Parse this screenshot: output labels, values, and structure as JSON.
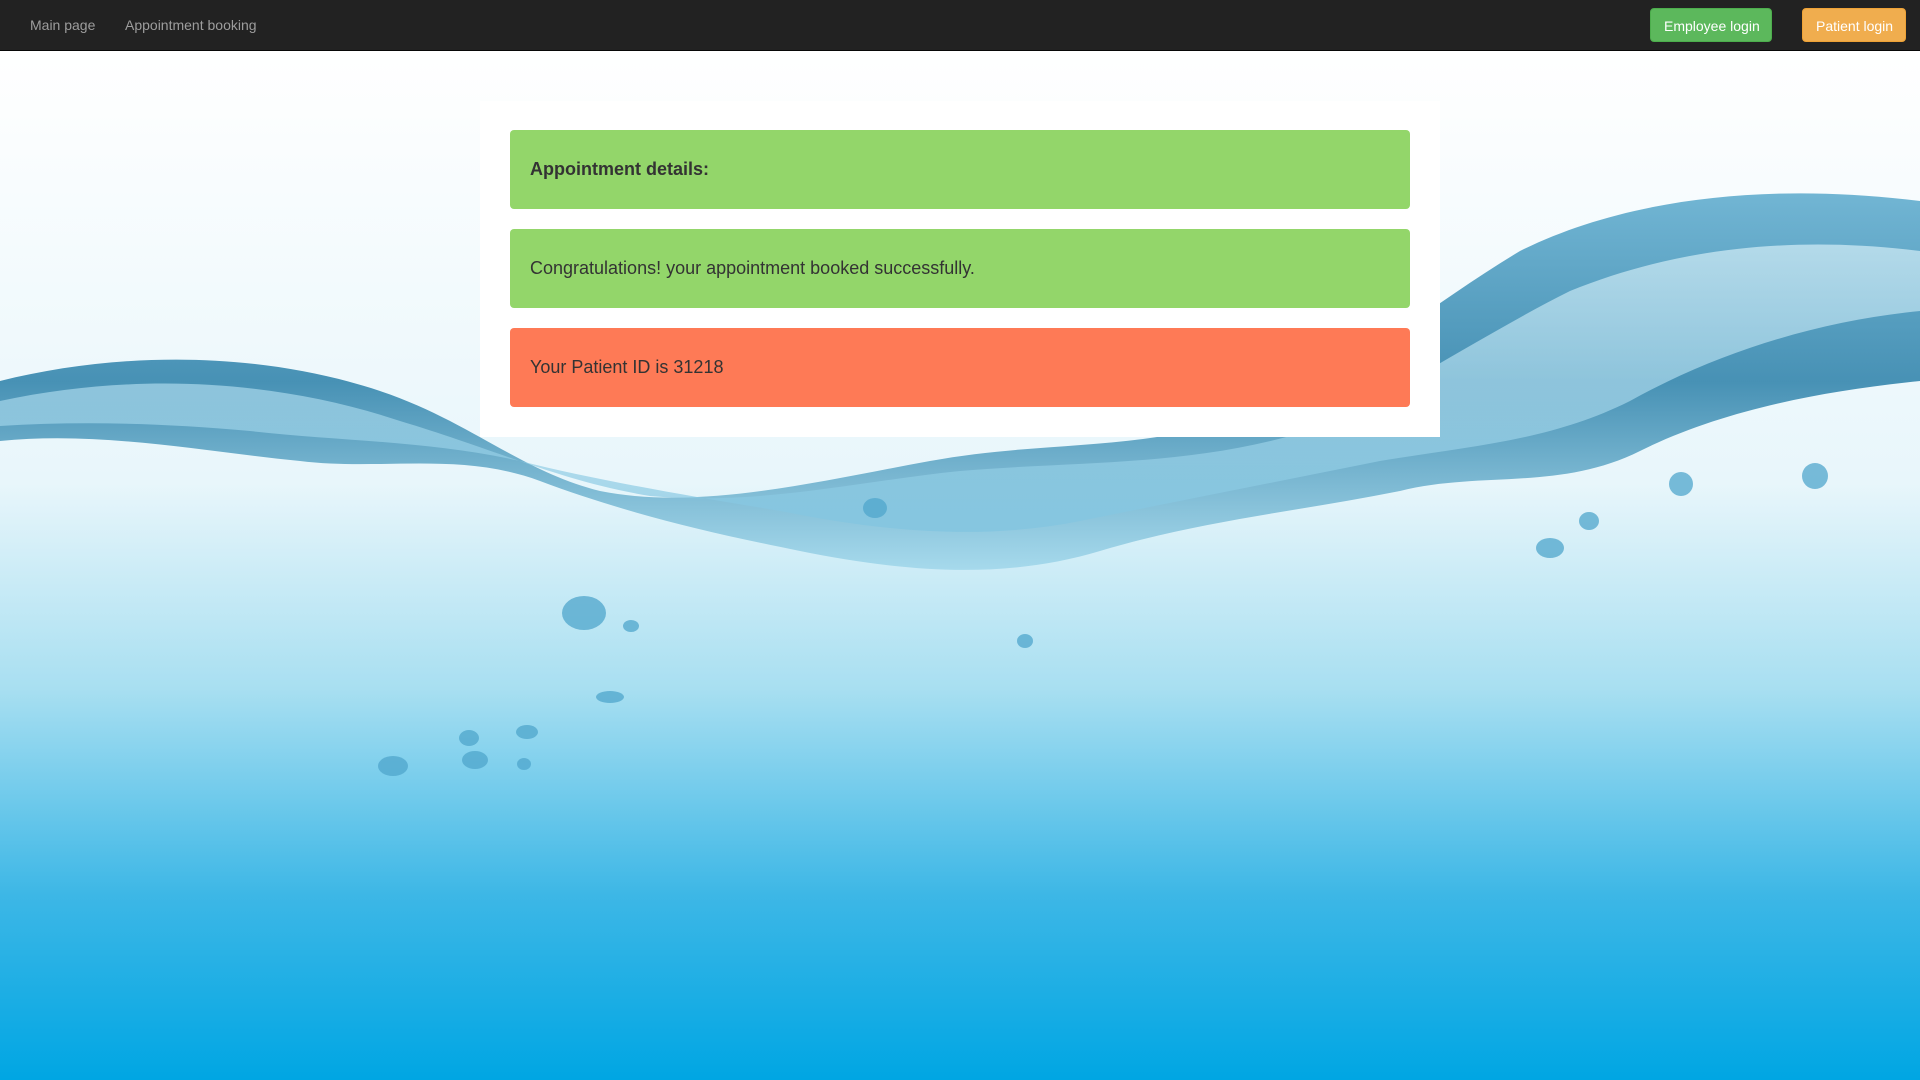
{
  "navbar": {
    "links": [
      {
        "label": "Main page"
      },
      {
        "label": "Appointment booking"
      }
    ],
    "employee_login_label": "Employee login",
    "patient_login_label": "Patient login",
    "colors": {
      "background": "#222222",
      "link": "#9d9d9d",
      "employee_button": "#5cb85c",
      "patient_button": "#f0ad4e"
    }
  },
  "content": {
    "heading": "Appointment details:",
    "success_message": "Congratulations! your appointment booked successfully.",
    "patient_id_message": "Your Patient ID is 31218",
    "colors": {
      "success": "#93d66a",
      "info": "#fe7a56"
    }
  },
  "background": {
    "subject": "water-splash"
  }
}
